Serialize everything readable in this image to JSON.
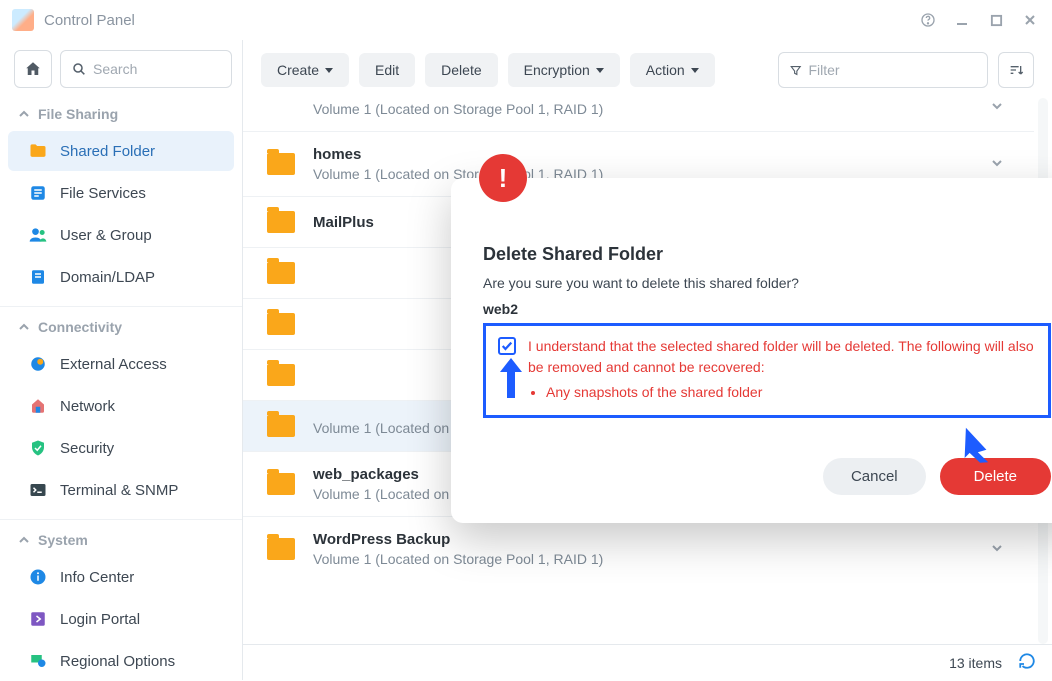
{
  "window": {
    "title": "Control Panel"
  },
  "search": {
    "placeholder": "Search"
  },
  "sideGroups": {
    "fileSharing": {
      "label": "File Sharing"
    },
    "connectivity": {
      "label": "Connectivity"
    },
    "system": {
      "label": "System"
    }
  },
  "sideItems": {
    "sharedFolder": "Shared Folder",
    "fileServices": "File Services",
    "userGroup": "User & Group",
    "domainLdap": "Domain/LDAP",
    "externalAccess": "External Access",
    "network": "Network",
    "security": "Security",
    "terminalSnmp": "Terminal & SNMP",
    "infoCenter": "Info Center",
    "loginPortal": "Login Portal",
    "regionalOptions": "Regional Options"
  },
  "toolbar": {
    "create": "Create",
    "edit": "Edit",
    "delete": "Delete",
    "encryption": "Encryption",
    "action": "Action",
    "filterPlaceholder": "Filter"
  },
  "folders": [
    {
      "name": "",
      "location": "Volume 1 (Located on Storage Pool 1, RAID 1)",
      "cut": true
    },
    {
      "name": "homes",
      "location": "Volume 1 (Located on Storage Pool 1, RAID 1)"
    },
    {
      "name": "MailPlus",
      "location": ""
    },
    {
      "name": "",
      "location": ""
    },
    {
      "name": "",
      "location": ""
    },
    {
      "name": "",
      "location": ""
    },
    {
      "name": "",
      "location": "Volume 1 (Located on Storage Pool 1, RAID 1)",
      "selected": true
    },
    {
      "name": "web_packages",
      "location": "Volume 1 (Located on Storage Pool 1, RAID 1)"
    },
    {
      "name": "WordPress Backup",
      "location": "Volume 1 (Located on Storage Pool 1, RAID 1)"
    }
  ],
  "status": {
    "items": "13 items"
  },
  "modal": {
    "title": "Delete Shared Folder",
    "prompt": "Are you sure you want to delete this shared folder?",
    "target": "web2",
    "confirmText": "I understand that the selected shared folder will be deleted. The following will also be removed and cannot be recovered:",
    "bullet1": "Any snapshots of the shared folder",
    "cancel": "Cancel",
    "delete": "Delete"
  }
}
